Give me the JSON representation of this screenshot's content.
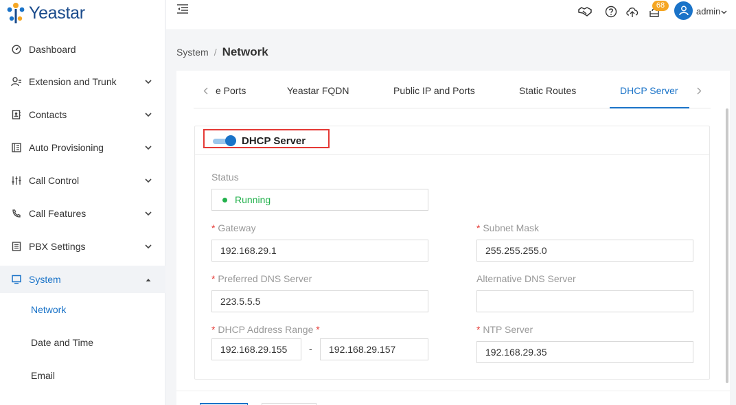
{
  "brand": {
    "name": "Yeastar"
  },
  "sidebar": {
    "items": [
      {
        "label": "Dashboard",
        "icon": "dashboard-icon"
      },
      {
        "label": "Extension and Trunk",
        "icon": "extension-icon"
      },
      {
        "label": "Contacts",
        "icon": "contacts-icon"
      },
      {
        "label": "Auto Provisioning",
        "icon": "provisioning-icon"
      },
      {
        "label": "Call Control",
        "icon": "call-control-icon"
      },
      {
        "label": "Call Features",
        "icon": "call-features-icon"
      },
      {
        "label": "PBX Settings",
        "icon": "pbx-settings-icon"
      },
      {
        "label": "System",
        "icon": "system-icon"
      }
    ],
    "sub_items": [
      {
        "label": "Network"
      },
      {
        "label": "Date and Time"
      },
      {
        "label": "Email"
      }
    ]
  },
  "header": {
    "notification_count": "68",
    "username": "admin"
  },
  "breadcrumb": {
    "parent": "System",
    "separator": "/",
    "current": "Network"
  },
  "tabs": [
    {
      "label": "e Ports"
    },
    {
      "label": "Yeastar FQDN"
    },
    {
      "label": "Public IP and Ports"
    },
    {
      "label": "Static Routes"
    },
    {
      "label": "DHCP Server"
    }
  ],
  "dhcp": {
    "title": "DHCP Server",
    "enabled": true,
    "status_label": "Status",
    "status_value": "Running",
    "gateway_label": "Gateway",
    "gateway_value": "192.168.29.1",
    "subnet_label": "Subnet Mask",
    "subnet_value": "255.255.255.0",
    "preferred_dns_label": "Preferred DNS Server",
    "preferred_dns_value": "223.5.5.5",
    "alt_dns_label": "Alternative DNS Server",
    "alt_dns_value": "",
    "range_label": "DHCP Address Range",
    "range_start": "192.168.29.155",
    "range_sep": "-",
    "range_end": "192.168.29.157",
    "ntp_label": "NTP Server",
    "ntp_value": "192.168.29.35",
    "required_mark": "*"
  },
  "colors": {
    "accent": "#1a73c8",
    "success": "#22b14c",
    "warning": "#f5a623",
    "danger": "#e53935"
  }
}
